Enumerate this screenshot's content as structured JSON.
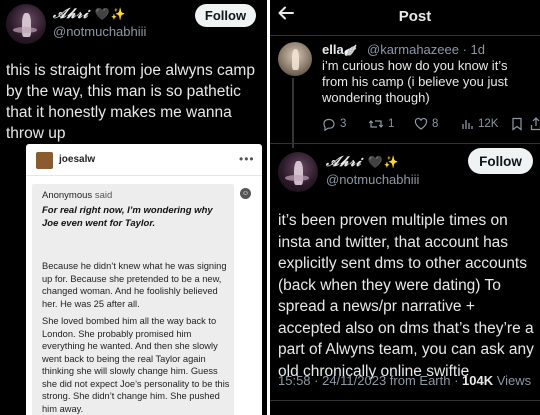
{
  "left": {
    "user": {
      "display_name": "𝒜𝒽𝓇𝒾",
      "emoji": "🖤✨",
      "handle": "@notmuchabhiii"
    },
    "follow_label": "Follow",
    "post_text": "this is straight from joe alwyns camp by the way, this man is so pathetic that it honestly makes me wanna throw up",
    "tumblr_card": {
      "username": "joesalw",
      "menu": "•••",
      "anon_label": "Anonymous",
      "anon_said": "said",
      "question": "For real right now, I’m wondering why Joe even went for Taylor.",
      "answer_1": "Because he didn’t knew what he was signing up for. Because she pretended to be a new, changed woman. And he foolishly believed her. He was 25 after all.",
      "answer_2": "She loved bombed him all the way back to London. She probably promised him everything he wanted. And then she slowly went back to being the real Taylor again thinking she will slowly change him. Guess she did not expect Joe’s personality to be this strong. She didn’t change him. She pushed him away."
    }
  },
  "right": {
    "header_title": "Post",
    "back_icon": "arrow-left-icon",
    "reply": {
      "name": "ella",
      "emoji": "🪽",
      "handle": "@karmahazeee · 1d",
      "text": "i’m curious how do you know it’s from his camp (i believe you just wondering though)",
      "stats": {
        "replies": "3",
        "reposts": "1",
        "likes": "8",
        "views": "12K"
      }
    },
    "main": {
      "display_name": "𝒜𝒽𝓇𝒾",
      "emoji": "🖤✨",
      "handle": "@notmuchabhiii",
      "follow_label": "Follow",
      "text": "it’s been proven multiple times on insta and twitter, that account has explicitly sent dms to other accounts (back when they were dating) To spread a news/pr narrative + accepted also on dms that’s they’re  a part of Alwyns team, you can ask any old chronically online swiftie",
      "timestamp": "15:58 · 24/11/2023 from Earth · ",
      "views_count": "104K",
      "views_label": " Views"
    }
  },
  "colors": {
    "background": "#000000",
    "text": "#e7e9ea",
    "muted": "#8b98a5",
    "follow_bg": "#eff3f4"
  }
}
